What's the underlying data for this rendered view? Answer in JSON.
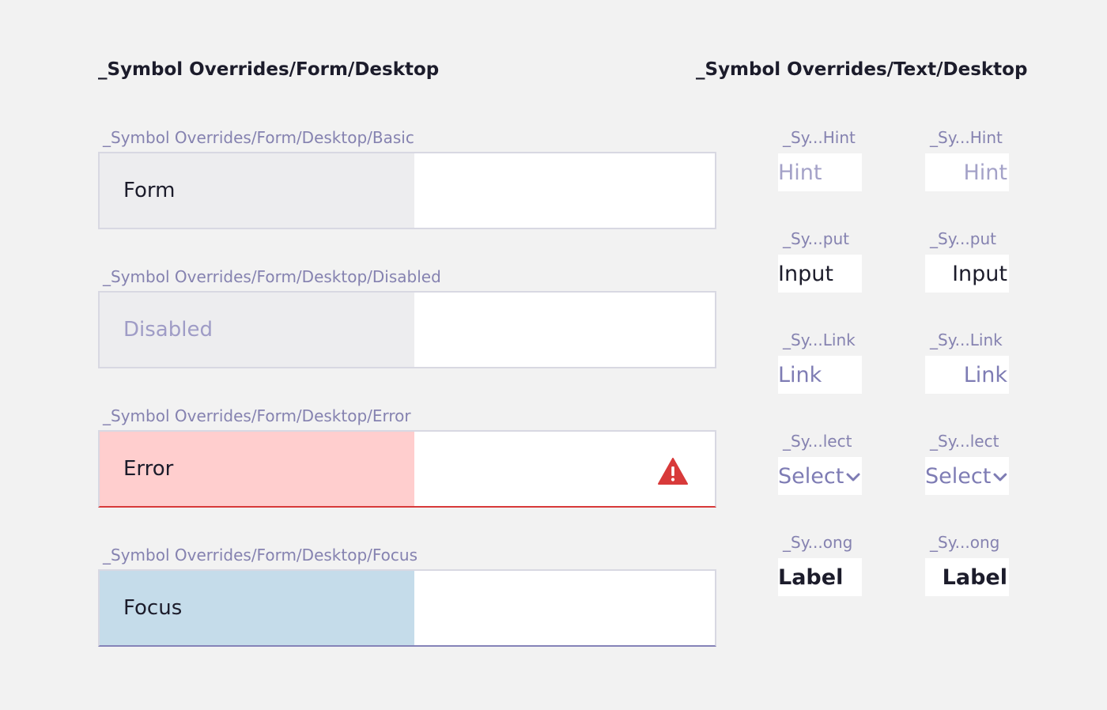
{
  "headers": {
    "form": "_Symbol Overrides/Form/Desktop",
    "text": "_Symbol Overrides/Text/Desktop"
  },
  "forms": [
    {
      "symbol": "_Symbol Overrides/Form/Desktop/Basic",
      "label": "Form"
    },
    {
      "symbol": "_Symbol Overrides/Form/Desktop/Disabled",
      "label": "Disabled"
    },
    {
      "symbol": "_Symbol Overrides/Form/Desktop/Error",
      "label": "Error"
    },
    {
      "symbol": "_Symbol Overrides/Form/Desktop/Focus",
      "label": "Focus"
    }
  ],
  "text_symbols": [
    {
      "symbol": "_Sy...Hint",
      "value": "Hint"
    },
    {
      "symbol": "_Sy...put",
      "value": "Input"
    },
    {
      "symbol": "_Sy...Link",
      "value": "Link"
    },
    {
      "symbol": "_Sy...lect",
      "value": "Select"
    },
    {
      "symbol": "_Sy...ong",
      "value": "Label"
    }
  ],
  "icons": {
    "error": "warning-triangle-icon",
    "select": "chevron-down-icon"
  },
  "colors": {
    "background": "#f2f2f2",
    "error_fill": "#ffcece",
    "error_line": "#d83a3a",
    "focus_fill": "#c5dcea",
    "focus_line": "#8583b8",
    "symbol_label": "#8582b0"
  }
}
